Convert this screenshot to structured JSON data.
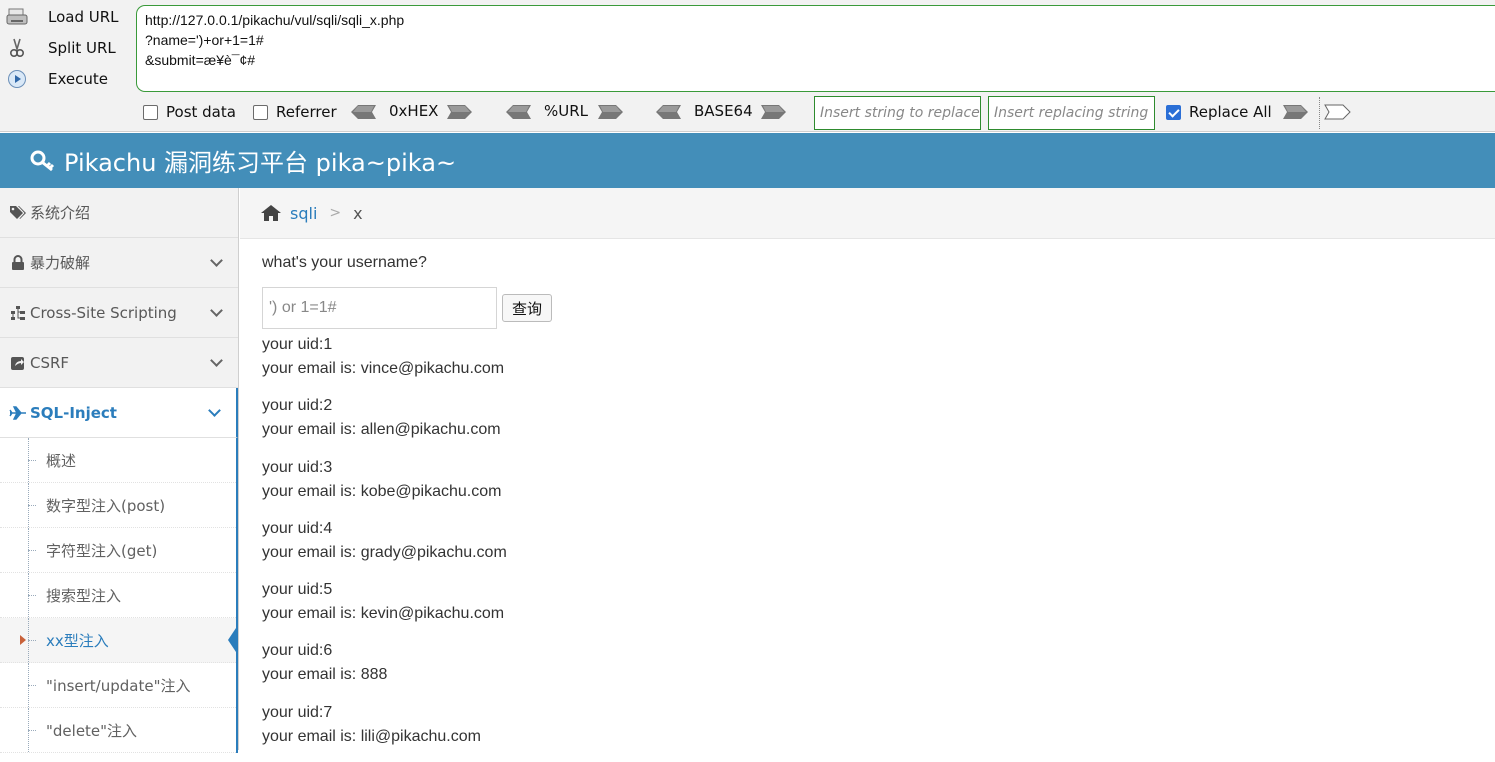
{
  "hackbar": {
    "load_url_label": "Load URL",
    "split_url_label": "Split URL",
    "execute_label": "Execute",
    "url_text": "http://127.0.0.1/pikachu/vul/sqli/sqli_x.php\n?name=')+or+1=1#\n&submit=æ¥è¯¢#",
    "post_data_label": "Post data",
    "referrer_label": "Referrer",
    "hex_label": "0xHEX",
    "urlenc_label": "%URL",
    "base64_label": "BASE64",
    "replace_placeholder": "Insert string to replace",
    "replacing_placeholder": "Insert replacing string",
    "replace_all_label": "Replace All",
    "post_data_checked": false,
    "referrer_checked": false,
    "replace_all_checked": true
  },
  "header": {
    "title": "Pikachu 漏洞练习平台 pika~pika~"
  },
  "sidebar": {
    "items": [
      {
        "label": "系统介绍",
        "icon": "tags-icon"
      },
      {
        "label": "暴力破解",
        "icon": "lock-icon"
      },
      {
        "label": "Cross-Site Scripting",
        "icon": "sitemap-icon"
      },
      {
        "label": "CSRF",
        "icon": "share-icon"
      },
      {
        "label": "SQL-Inject",
        "icon": "plane-icon"
      }
    ],
    "sub_items": [
      {
        "label": "概述"
      },
      {
        "label": "数字型注入(post)"
      },
      {
        "label": "字符型注入(get)"
      },
      {
        "label": "搜索型注入"
      },
      {
        "label": "xx型注入"
      },
      {
        "label": "\"insert/update\"注入"
      },
      {
        "label": "\"delete\"注入"
      }
    ]
  },
  "breadcrumb": {
    "parent": "sqli",
    "current": "x"
  },
  "main": {
    "question": "what's your username?",
    "input_value": "') or 1=1#",
    "submit_label": "查询",
    "results": [
      {
        "uid": "your uid:1",
        "email": "your email is: vince@pikachu.com"
      },
      {
        "uid": "your uid:2",
        "email": "your email is: allen@pikachu.com"
      },
      {
        "uid": "your uid:3",
        "email": "your email is: kobe@pikachu.com"
      },
      {
        "uid": "your uid:4",
        "email": "your email is: grady@pikachu.com"
      },
      {
        "uid": "your uid:5",
        "email": "your email is: kevin@pikachu.com"
      },
      {
        "uid": "your uid:6",
        "email": "your email is: 888"
      },
      {
        "uid": "your uid:7",
        "email": "your email is: lili@pikachu.com"
      }
    ]
  },
  "colors": {
    "header_bg": "#438eb9",
    "link": "#2b7dbc",
    "hackbar_border": "#3a9a3a"
  }
}
